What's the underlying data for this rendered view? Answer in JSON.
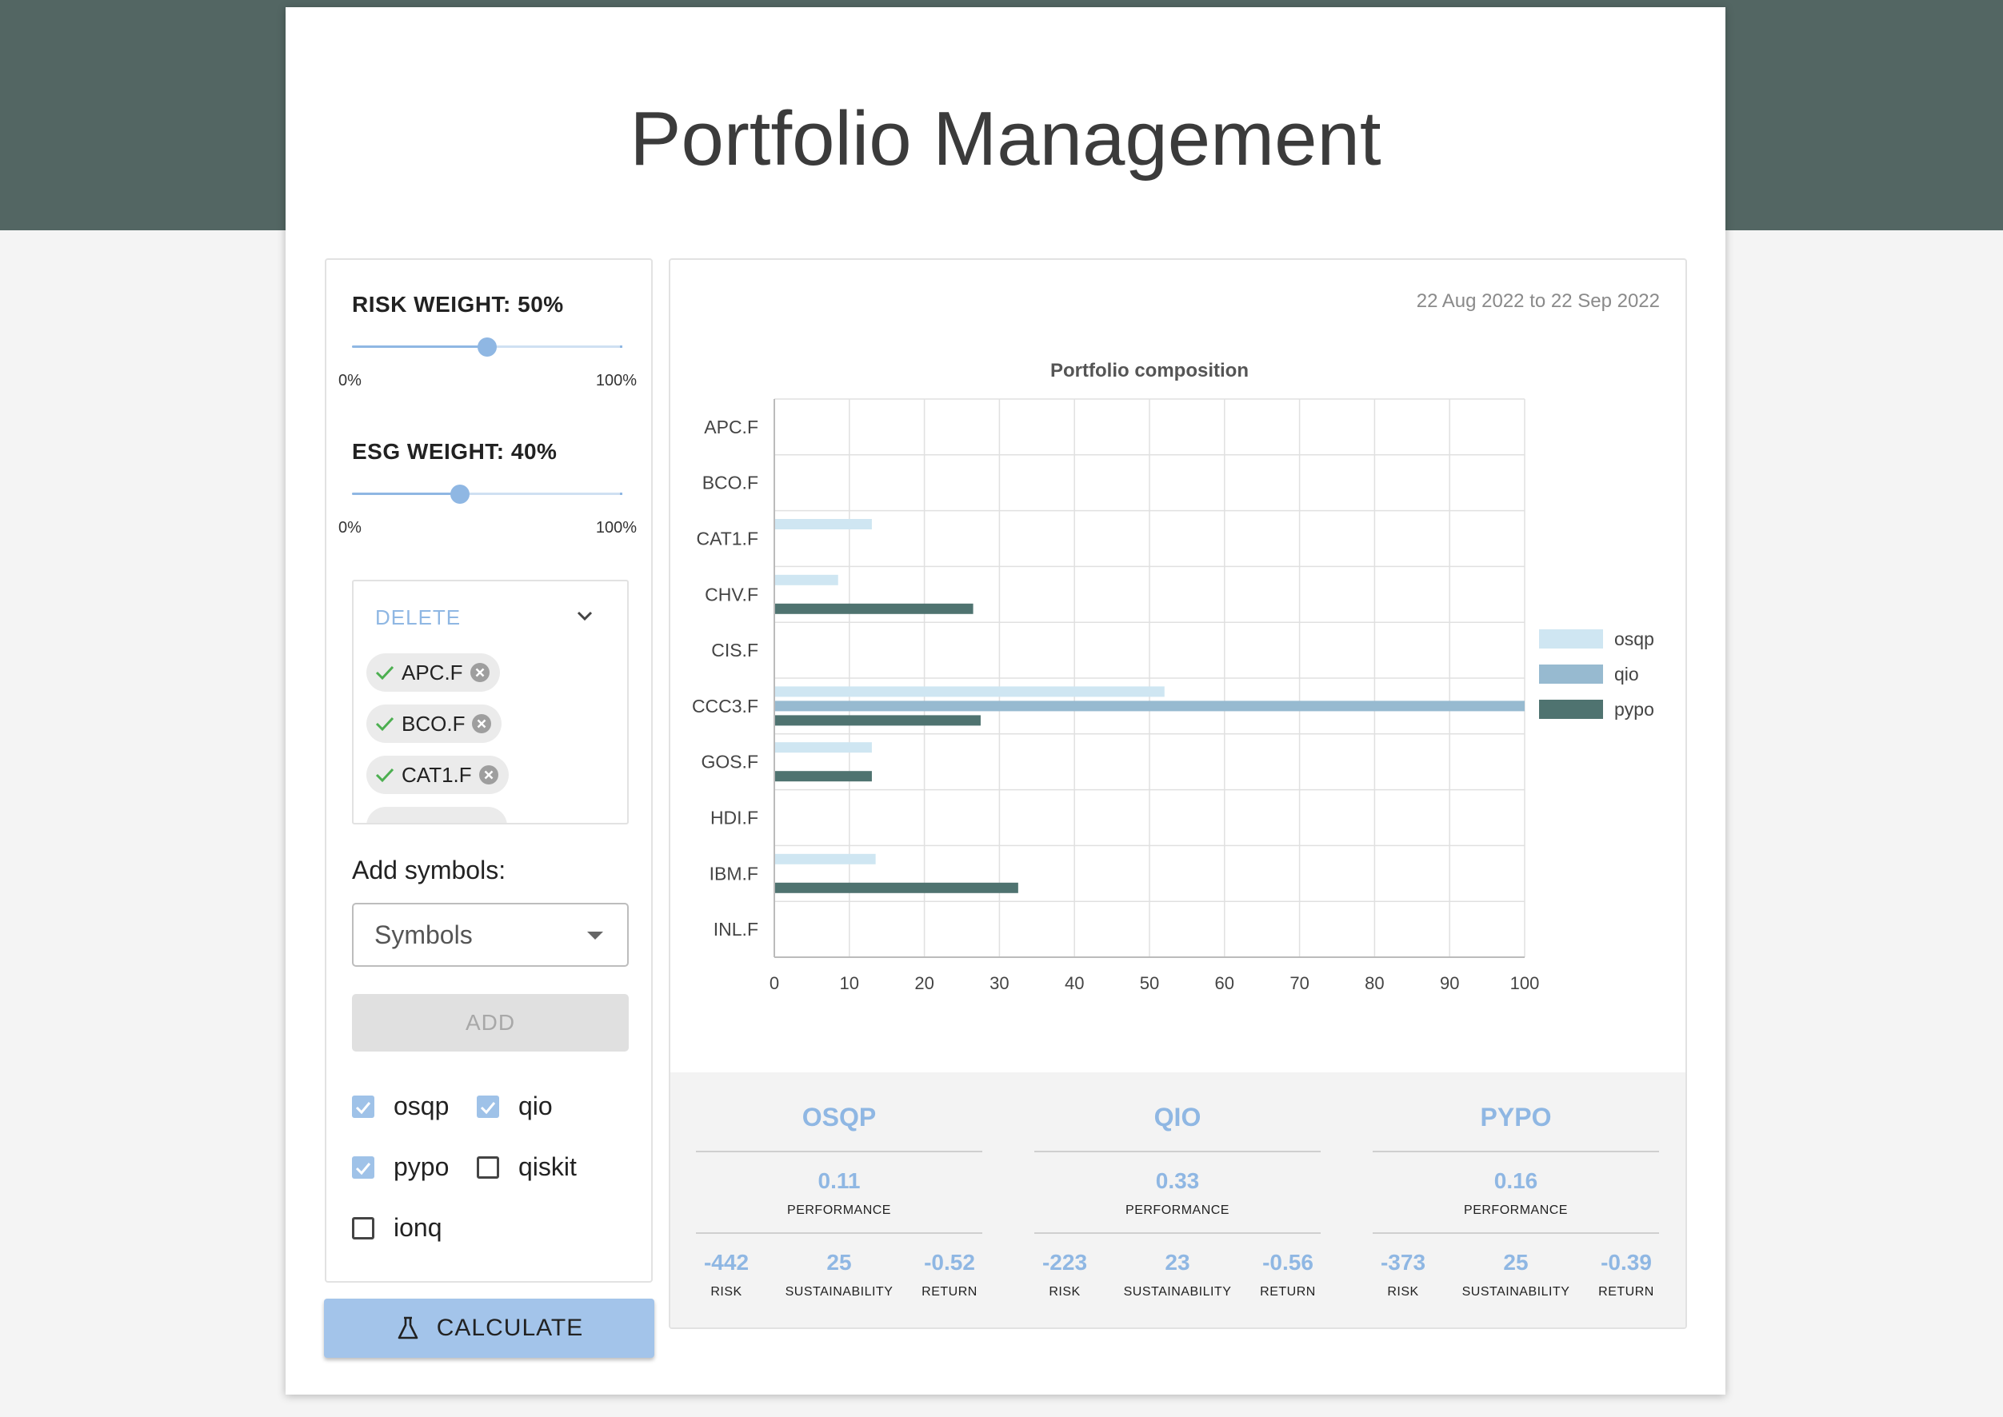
{
  "app": {
    "title": "Portfolio Management"
  },
  "risk": {
    "label": "RISK WEIGHT: 50%",
    "value_pct": 50,
    "min": "0%",
    "max": "100%"
  },
  "esg": {
    "label": "ESG WEIGHT: 40%",
    "value_pct": 40,
    "min": "0%",
    "max": "100%"
  },
  "delete_box": {
    "label": "DELETE",
    "chips": [
      "APC.F",
      "BCO.F",
      "CAT1.F"
    ]
  },
  "add": {
    "label": "Add symbols:",
    "placeholder": "Symbols",
    "button": "ADD"
  },
  "solvers": [
    {
      "label": "osqp",
      "checked": true
    },
    {
      "label": "qio",
      "checked": true
    },
    {
      "label": "pypo",
      "checked": true
    },
    {
      "label": "qiskit",
      "checked": false
    },
    {
      "label": "ionq",
      "checked": false
    }
  ],
  "calculate": {
    "label": "CALCULATE"
  },
  "date_range": "22 Aug 2022 to 22 Sep 2022",
  "chart_data": {
    "type": "bar",
    "orientation": "horizontal",
    "title": "Portfolio composition",
    "categories": [
      "APC.F",
      "BCO.F",
      "CAT1.F",
      "CHV.F",
      "CIS.F",
      "CCC3.F",
      "GOS.F",
      "HDI.F",
      "IBM.F",
      "INL.F"
    ],
    "series": [
      {
        "name": "osqp",
        "color": "#cfe6f2",
        "values": [
          0,
          0,
          13,
          8.5,
          0,
          52,
          13,
          0,
          13.5,
          0
        ]
      },
      {
        "name": "qio",
        "color": "#97bad0",
        "values": [
          0,
          0,
          0,
          0,
          0,
          100,
          0,
          0,
          0,
          0
        ]
      },
      {
        "name": "pypo",
        "color": "#4f7370",
        "values": [
          0,
          0,
          0,
          26.5,
          0,
          27.5,
          13,
          0,
          32.5,
          0
        ]
      }
    ],
    "xlim": [
      0,
      100
    ],
    "xticks": [
      "0",
      "10",
      "20",
      "30",
      "40",
      "50",
      "60",
      "70",
      "80",
      "90",
      "100"
    ],
    "grid": true,
    "legend": "right"
  },
  "stats": [
    {
      "name": "OSQP",
      "performance": "0.11",
      "perf_label": "PERFORMANCE",
      "risk": "-442",
      "sustainability": "25",
      "return": "-0.52"
    },
    {
      "name": "QIO",
      "performance": "0.33",
      "perf_label": "PERFORMANCE",
      "risk": "-223",
      "sustainability": "23",
      "return": "-0.56"
    },
    {
      "name": "PYPO",
      "performance": "0.16",
      "perf_label": "PERFORMANCE",
      "risk": "-373",
      "sustainability": "25",
      "return": "-0.39"
    }
  ],
  "stat_labels": {
    "risk": "RISK",
    "sustainability": "SUSTAINABILITY",
    "return": "RETURN"
  }
}
